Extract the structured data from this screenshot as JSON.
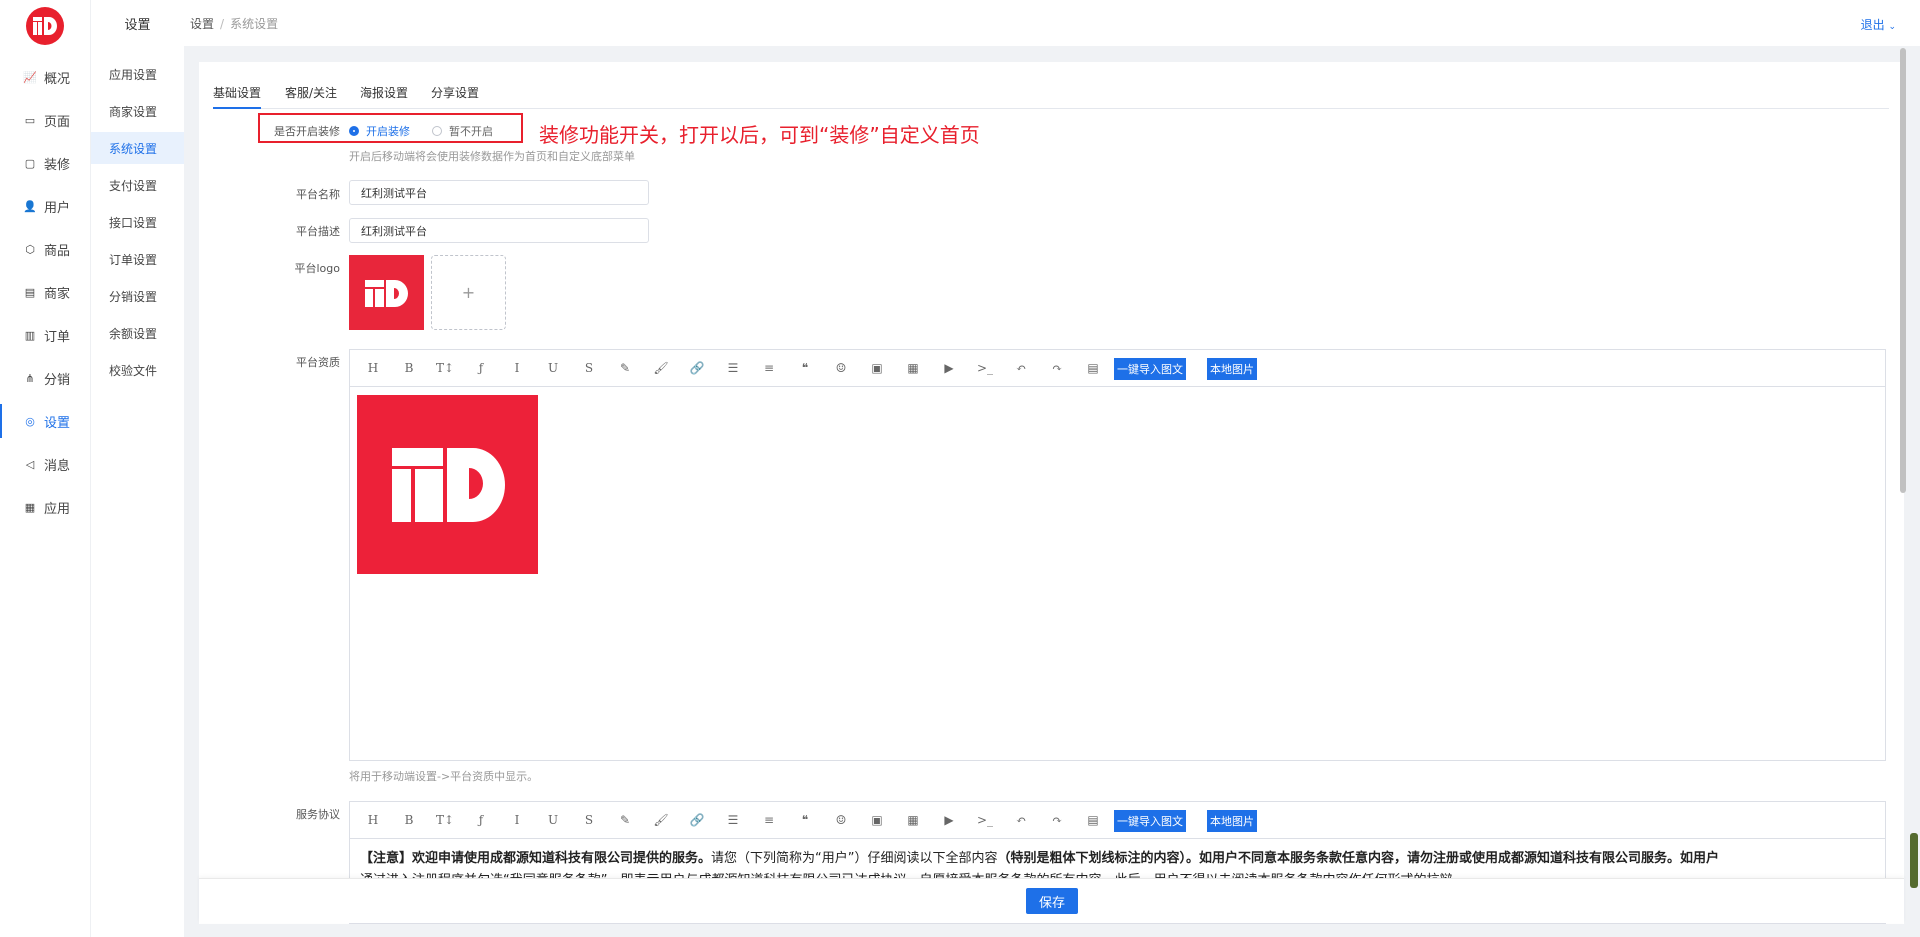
{
  "nav1": {
    "items": [
      {
        "label": "概况",
        "icon": "chart-icon"
      },
      {
        "label": "页面",
        "icon": "page-icon"
      },
      {
        "label": "装修",
        "icon": "decorate-icon"
      },
      {
        "label": "用户",
        "icon": "user-icon"
      },
      {
        "label": "商品",
        "icon": "box-icon"
      },
      {
        "label": "商家",
        "icon": "store-icon"
      },
      {
        "label": "订单",
        "icon": "order-icon"
      },
      {
        "label": "分销",
        "icon": "distribution-icon"
      },
      {
        "label": "设置",
        "icon": "settings-icon"
      },
      {
        "label": "消息",
        "icon": "message-icon"
      },
      {
        "label": "应用",
        "icon": "apps-icon"
      }
    ],
    "active_index": 8
  },
  "nav2": {
    "title": "设置",
    "items": [
      "应用设置",
      "商家设置",
      "系统设置",
      "支付设置",
      "接口设置",
      "订单设置",
      "分销设置",
      "余额设置",
      "校验文件"
    ],
    "active_index": 2
  },
  "header": {
    "crumb_root": "设置",
    "crumb_sep": "/",
    "crumb_current": "系统设置",
    "logout": "退出"
  },
  "tabs": [
    "基础设置",
    "客服/关注",
    "海报设置",
    "分享设置"
  ],
  "form": {
    "decor_label": "是否开启装修",
    "decor_on": "开启装修",
    "decor_off": "暂不开启",
    "decor_help": "开启后移动端将会使用装修数据作为首页和自定义底部菜单",
    "annotation": "装修功能开关，打开以后，可到“装修”自定义首页",
    "name_label": "平台名称",
    "name_value": "红利测试平台",
    "desc_label": "平台描述",
    "desc_value": "红利测试平台",
    "logo_label": "平台logo",
    "upload_plus": "+",
    "qual_label": "平台资质",
    "qual_help": "将用于移动端设置->平台资质中显示。",
    "service_label": "服务协议"
  },
  "toolbar": {
    "icons": [
      {
        "name": "heading-icon",
        "glyph": "H"
      },
      {
        "name": "bold-icon",
        "glyph": "B"
      },
      {
        "name": "font-size-icon",
        "glyph": "T↕"
      },
      {
        "name": "font-family-icon",
        "glyph": "ƒ"
      },
      {
        "name": "italic-icon",
        "glyph": "I"
      },
      {
        "name": "underline-icon",
        "glyph": "U"
      },
      {
        "name": "strikethrough-icon",
        "glyph": "S"
      },
      {
        "name": "highlight-icon",
        "glyph": "✎"
      },
      {
        "name": "brush-icon",
        "glyph": "🖌"
      },
      {
        "name": "link-icon",
        "glyph": "🔗"
      },
      {
        "name": "list-icon",
        "glyph": "☰"
      },
      {
        "name": "align-icon",
        "glyph": "≡"
      },
      {
        "name": "quote-icon",
        "glyph": "❝"
      },
      {
        "name": "emoji-icon",
        "glyph": "☺"
      },
      {
        "name": "image-icon",
        "glyph": "▣"
      },
      {
        "name": "table-icon",
        "glyph": "▦"
      },
      {
        "name": "video-icon",
        "glyph": "▶"
      },
      {
        "name": "code-icon",
        "glyph": ">_"
      },
      {
        "name": "undo-icon",
        "glyph": "↶"
      },
      {
        "name": "redo-icon",
        "glyph": "↷"
      },
      {
        "name": "plugin-icon",
        "glyph": "▤"
      }
    ],
    "import_btn": "一键导入图文",
    "local_img_btn": "本地图片"
  },
  "terms": {
    "part1": "【注意】欢迎申请使用成都源知道科技有限公司提供的服务。",
    "part2": "请您（下列简称为“用户”）仔细阅读以下全部内容",
    "part3": "（特别是粗体下划线标注的内容）",
    "part4": "。如用户不同意本服务条款任意内容，请勿注册或使用成都源知道科技有限公司服务。如用户",
    "line2": "通过进入注册程序并勾选“我同意服务条款”，即表示用户与成都源知道科技有限公司已达成协议，自愿接受本服务条款的所有内容。此后，用户不得以未阅读本服务条款内容作任何形式的抗辩。"
  },
  "save_btn": "保存",
  "colors": {
    "accent": "#1e70e8",
    "brand_red": "#e8202d"
  }
}
